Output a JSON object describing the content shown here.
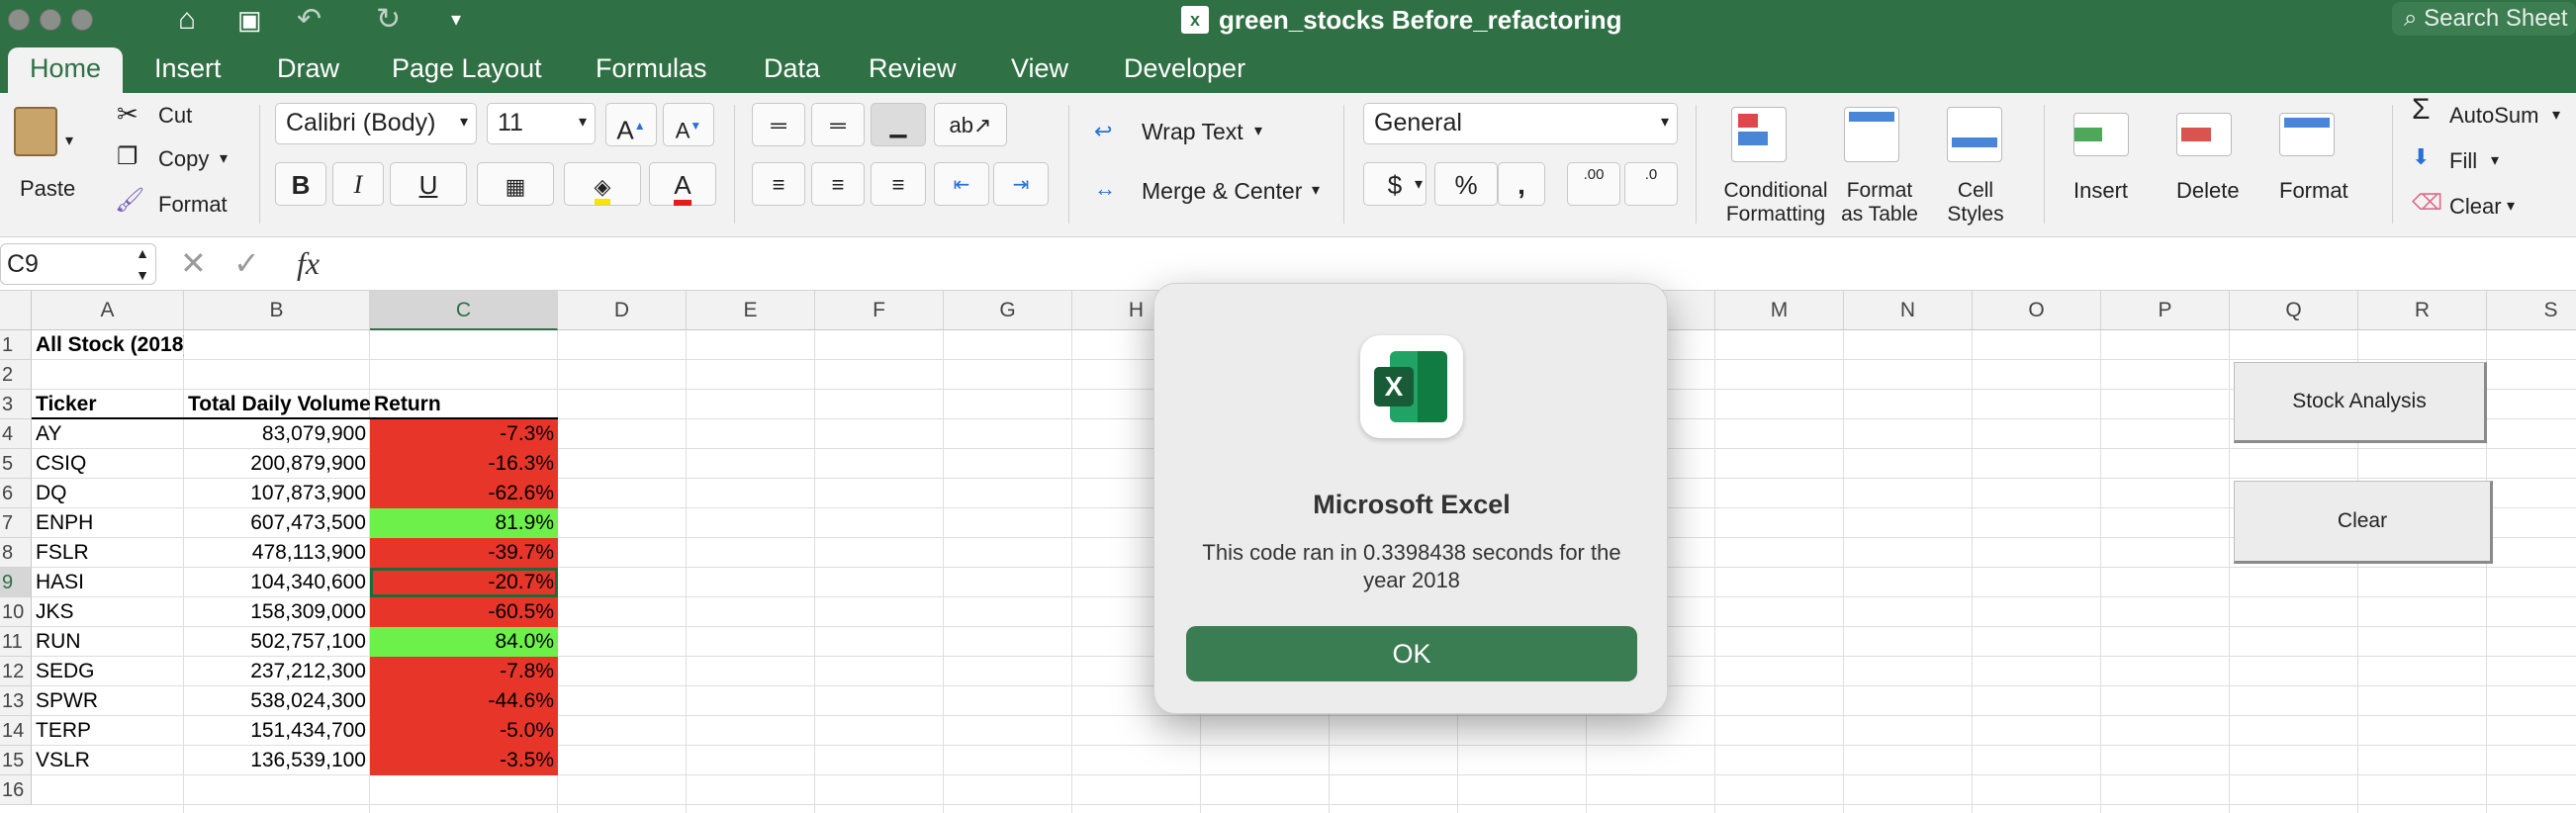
{
  "window": {
    "title": "green_stocks Before_refactoring",
    "search_placeholder": "Search Sheet"
  },
  "tabs": [
    "Home",
    "Insert",
    "Draw",
    "Page Layout",
    "Formulas",
    "Data",
    "Review",
    "View",
    "Developer"
  ],
  "ribbon": {
    "paste": "Paste",
    "cut": "Cut",
    "copy": "Copy",
    "format_painter": "Format",
    "font_name": "Calibri (Body)",
    "font_size": "11",
    "bold": "B",
    "italic": "I",
    "underline": "U",
    "wrap_text": "Wrap Text",
    "merge_center": "Merge & Center",
    "number_format": "General",
    "currency": "$",
    "percent": "%",
    "comma": ",",
    "inc_decimal": ".00",
    "dec_decimal": ".0",
    "conditional_formatting_1": "Conditional",
    "conditional_formatting_2": "Formatting",
    "format_table_1": "Format",
    "format_table_2": "as Table",
    "cell_styles_1": "Cell",
    "cell_styles_2": "Styles",
    "insert": "Insert",
    "delete": "Delete",
    "format": "Format",
    "autosum": "AutoSum",
    "fill": "Fill",
    "clear": "Clear"
  },
  "formula_bar": {
    "name_box": "C9",
    "fx": "fx",
    "content": ""
  },
  "columns": [
    "A",
    "B",
    "C",
    "D",
    "E",
    "F",
    "G",
    "H",
    "I",
    "J",
    "K",
    "L",
    "M",
    "N",
    "O",
    "P",
    "Q",
    "R",
    "S"
  ],
  "rows": [
    "1",
    "2",
    "3",
    "4",
    "5",
    "6",
    "7",
    "8",
    "9",
    "10",
    "11",
    "12",
    "13",
    "14",
    "15",
    "16"
  ],
  "sheet": {
    "title": "All Stock (2018)",
    "headers": [
      "Ticker",
      "Total Daily Volume",
      "Return"
    ],
    "data": [
      {
        "ticker": "AY",
        "volume": "83,079,900",
        "ret": "-7.3%",
        "status": "neg"
      },
      {
        "ticker": "CSIQ",
        "volume": "200,879,900",
        "ret": "-16.3%",
        "status": "neg"
      },
      {
        "ticker": "DQ",
        "volume": "107,873,900",
        "ret": "-62.6%",
        "status": "neg"
      },
      {
        "ticker": "ENPH",
        "volume": "607,473,500",
        "ret": "81.9%",
        "status": "pos"
      },
      {
        "ticker": "FSLR",
        "volume": "478,113,900",
        "ret": "-39.7%",
        "status": "neg"
      },
      {
        "ticker": "HASI",
        "volume": "104,340,600",
        "ret": "-20.7%",
        "status": "neg"
      },
      {
        "ticker": "JKS",
        "volume": "158,309,000",
        "ret": "-60.5%",
        "status": "neg"
      },
      {
        "ticker": "RUN",
        "volume": "502,757,100",
        "ret": "84.0%",
        "status": "pos"
      },
      {
        "ticker": "SEDG",
        "volume": "237,212,300",
        "ret": "-7.8%",
        "status": "neg"
      },
      {
        "ticker": "SPWR",
        "volume": "538,024,300",
        "ret": "-44.6%",
        "status": "neg"
      },
      {
        "ticker": "TERP",
        "volume": "151,434,700",
        "ret": "-5.0%",
        "status": "neg"
      },
      {
        "ticker": "VSLR",
        "volume": "136,539,100",
        "ret": "-3.5%",
        "status": "neg"
      }
    ],
    "buttons": {
      "stock_analysis": "Stock Analysis",
      "clear": "Clear"
    }
  },
  "dialog": {
    "title": "Microsoft Excel",
    "message": "This code ran in 0.3398438 seconds for the year 2018",
    "ok": "OK"
  },
  "colors": {
    "brand": "#2f7044",
    "negative": "#e8352a",
    "positive": "#6ef04a",
    "ok_button": "#3b7d53"
  }
}
